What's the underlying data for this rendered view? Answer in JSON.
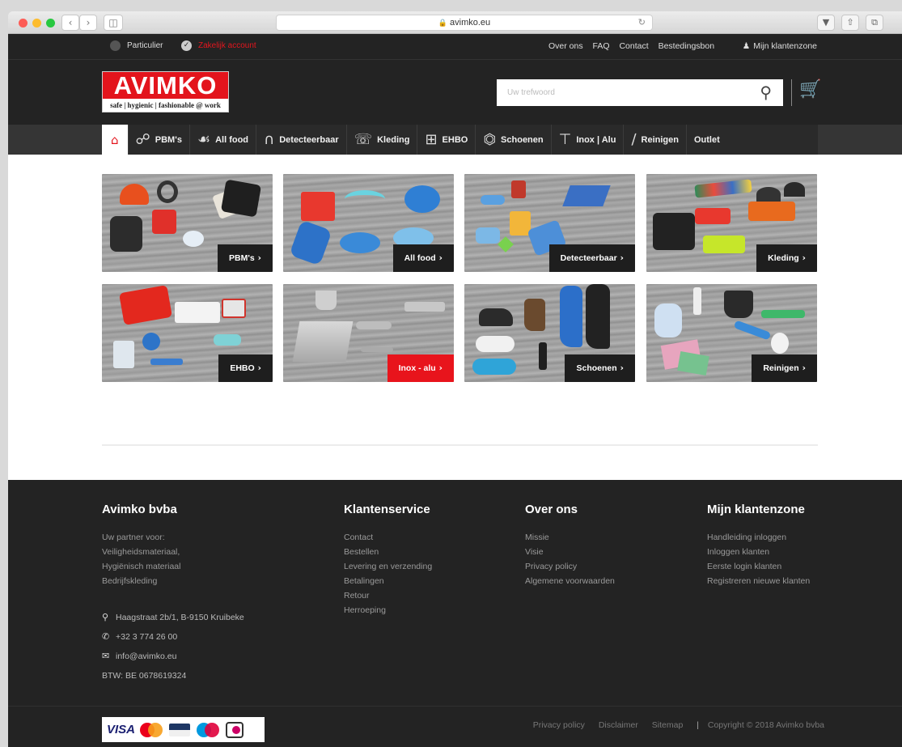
{
  "browser": {
    "url": "avimko.eu"
  },
  "topbar": {
    "particulier": "Particulier",
    "zakelijk": "Zakelijk account",
    "links": [
      "Over ons",
      "FAQ",
      "Contact",
      "Bestedingsbon"
    ],
    "klantenzone": "Mijn klantenzone"
  },
  "header": {
    "logo_main": "AVIMKO",
    "logo_sub": "safe | hygienic | fashionable @ work",
    "search_placeholder": "Uw trefwoord"
  },
  "nav": {
    "items": [
      {
        "label": "PBM's",
        "icon": "helmet-icon"
      },
      {
        "label": "All food",
        "icon": "food-icon"
      },
      {
        "label": "Detecteerbaar",
        "icon": "magnet-icon"
      },
      {
        "label": "Kleding",
        "icon": "shirt-icon"
      },
      {
        "label": "EHBO",
        "icon": "first-aid-icon"
      },
      {
        "label": "Schoenen",
        "icon": "shoe-icon"
      },
      {
        "label": "Inox | Alu",
        "icon": "beam-icon"
      },
      {
        "label": "Reinigen",
        "icon": "broom-icon"
      },
      {
        "label": "Outlet",
        "icon": ""
      }
    ]
  },
  "tiles": [
    {
      "label": "PBM's"
    },
    {
      "label": "All food"
    },
    {
      "label": "Detecteerbaar"
    },
    {
      "label": "Kleding"
    },
    {
      "label": "EHBO"
    },
    {
      "label": "Inox - alu"
    },
    {
      "label": "Schoenen"
    },
    {
      "label": "Reinigen"
    }
  ],
  "footer": {
    "company": {
      "title": "Avimko bvba",
      "lines": [
        "Uw partner voor:",
        "Veiligheidsmateriaal,",
        "Hygiënisch materiaal",
        "Bedrijfskleding"
      ],
      "address": "Haagstraat 2b/1, B-9150 Kruibeke",
      "phone": "+32 3 774 26 00",
      "email": "info@avimko.eu",
      "btw": "BTW: BE 0678619324"
    },
    "klantenservice": {
      "title": "Klantenservice",
      "links": [
        "Contact",
        "Bestellen",
        "Levering en verzending",
        "Betalingen",
        "Retour",
        "Herroeping"
      ]
    },
    "overons": {
      "title": "Over ons",
      "links": [
        "Missie",
        "Visie",
        "Privacy policy",
        "Algemene voorwaarden"
      ]
    },
    "klantenzone": {
      "title": "Mijn klantenzone",
      "links": [
        "Handleiding inloggen",
        "Inloggen klanten",
        "Eerste login klanten",
        "Registreren nieuwe klanten"
      ]
    },
    "bottom_links": [
      "Privacy policy",
      "Disclaimer",
      "Sitemap"
    ],
    "copyright": "Copyright © 2018 Avimko bvba",
    "payment_visa": "VISA"
  },
  "colors": {
    "brand_red": "#e3141c",
    "dark": "#232323"
  }
}
